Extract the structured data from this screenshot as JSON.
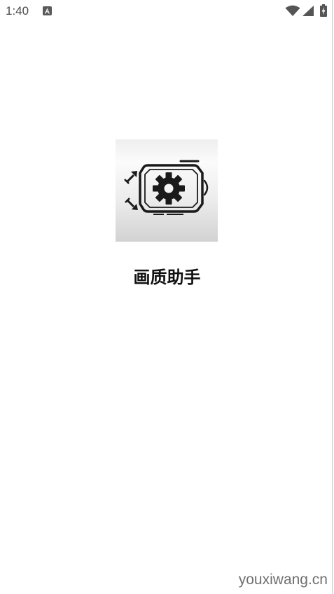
{
  "status_bar": {
    "time": "1:40",
    "notification_icon": "a-app-notification-icon",
    "right_icons": [
      "wifi-icon",
      "cell-signal-icon",
      "battery-charging-icon"
    ]
  },
  "splash": {
    "app_icon": "gpu-settings-icon",
    "app_name": "画质助手"
  },
  "watermark": {
    "text": "youxiwang.cn"
  },
  "colors": {
    "background": "#ffffff",
    "title": "#111111",
    "status_text": "#4a4a4a",
    "watermark": "#6f6f6f"
  }
}
